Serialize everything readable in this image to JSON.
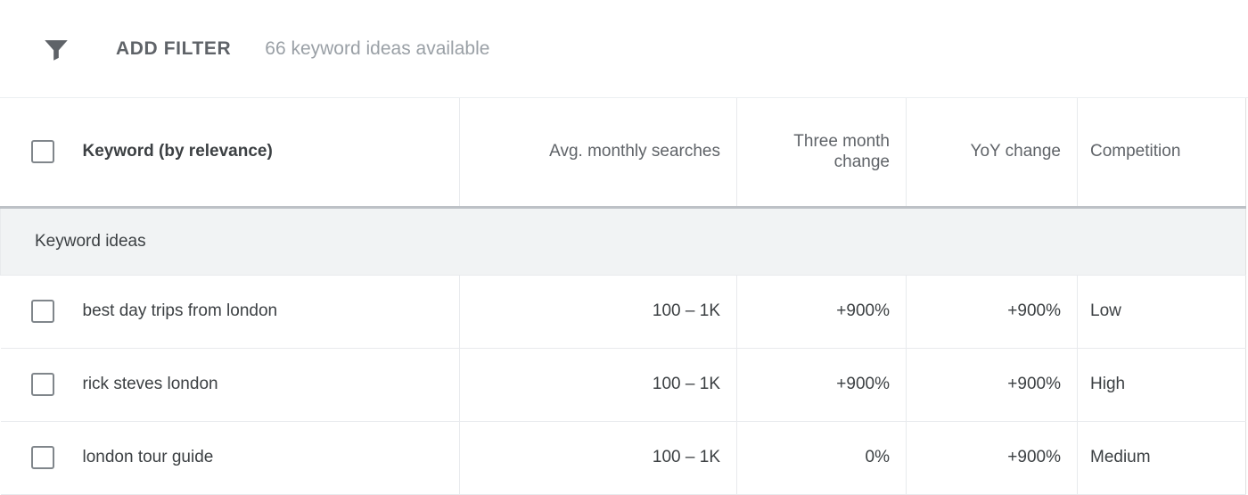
{
  "filter_bar": {
    "icon": "funnel-icon",
    "add_filter_label": "ADD FILTER",
    "ideas_count_text": "66 keyword ideas available"
  },
  "table": {
    "columns": [
      {
        "label": "Keyword (by relevance)",
        "align": "left"
      },
      {
        "label": "Avg. monthly searches",
        "align": "right"
      },
      {
        "label": "Three month change",
        "align": "right"
      },
      {
        "label": "YoY change",
        "align": "right"
      },
      {
        "label": "Competition",
        "align": "left"
      }
    ],
    "group_label": "Keyword ideas",
    "rows": [
      {
        "keyword": "best day trips from london",
        "avg_monthly_searches": "100 – 1K",
        "three_month_change": "+900%",
        "yoy_change": "+900%",
        "competition": "Low"
      },
      {
        "keyword": "rick steves london",
        "avg_monthly_searches": "100 – 1K",
        "three_month_change": "+900%",
        "yoy_change": "+900%",
        "competition": "High"
      },
      {
        "keyword": "london tour guide",
        "avg_monthly_searches": "100 – 1K",
        "three_month_change": "0%",
        "yoy_change": "+900%",
        "competition": "Medium"
      }
    ]
  },
  "colors": {
    "text_primary": "#3c4043",
    "text_secondary": "#5f6368",
    "text_muted": "#9aa0a6",
    "group_row_bg": "#f1f3f4",
    "border": "#e8eaed",
    "header_underline": "#bdc1c6"
  }
}
